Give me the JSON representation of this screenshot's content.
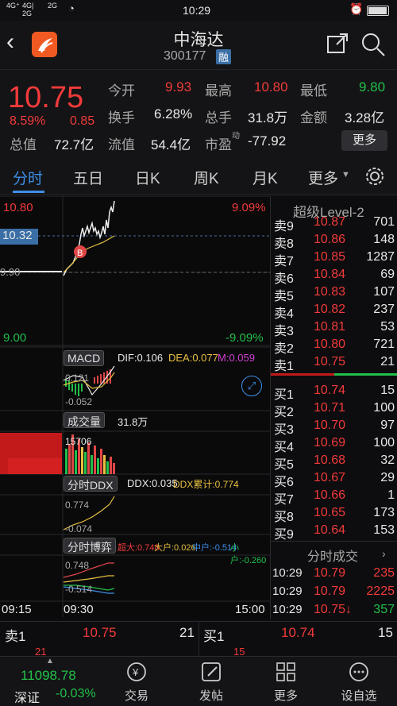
{
  "status": {
    "network_1": "4G⁺",
    "network_2": "4G|",
    "network_2b": "2G",
    "network_3": "2G",
    "time": "10:29",
    "battery": "98"
  },
  "header": {
    "title": "中海达",
    "code": "300177",
    "badge": "融"
  },
  "quote": {
    "price": "10.75",
    "change_pct": "8.59%",
    "change": "0.85",
    "rows": [
      {
        "l1": "今开",
        "v1": "9.93",
        "l2": "最高",
        "v2": "10.80",
        "l3": "最低",
        "v3": "9.80"
      },
      {
        "l1": "换手",
        "v1": "6.28%",
        "l2": "总手",
        "v2": "31.8万",
        "l3": "金额",
        "v3": "3.28亿"
      }
    ],
    "row3": {
      "l0": "总值",
      "v0": "72.7亿",
      "l1": "流值",
      "v1": "54.4亿",
      "l2": "市盈",
      "l2sup": "动",
      "v2": "-77.92"
    },
    "more_button": "更多"
  },
  "tabs": [
    "分时",
    "五日",
    "日K",
    "周K",
    "月K",
    "更多"
  ],
  "chart": {
    "top_left": "10.80",
    "top_right": "9.09%",
    "current": "10.32",
    "mid": "9.90",
    "bottom_left": "9.00",
    "bottom_right": "-9.09%",
    "marker": "B",
    "macd_label": "MACD",
    "dif": "DIF:0.106",
    "dea": "DEA:0.077",
    "m": "M:0.059",
    "macd_top": "0.121",
    "macd_bottom": "-0.052",
    "vol_label": "成交量",
    "vol_value": "31.8万",
    "vol_max": "15706",
    "ddx_label": "分时DDX",
    "ddx_value": "DDX:0.035",
    "ddx_cum": "DDX累计:0.774",
    "ddx_top": "0.774",
    "ddx_bottom": "-0.074",
    "game_label": "分时博弈",
    "game_super": "超大:0.748",
    "game_big": "大户:0.026",
    "game_mid": "中户:-0.514",
    "game_small": "小户:-0.260",
    "game_top": "0.748",
    "game_bottom": "-0.514",
    "time_start": "09:15",
    "time_mid": "09:30",
    "time_end": "15:00"
  },
  "book": {
    "title": "超级Level-2",
    "asks": [
      {
        "label": "卖9",
        "price": "10.87",
        "vol": "701"
      },
      {
        "label": "卖8",
        "price": "10.86",
        "vol": "148"
      },
      {
        "label": "卖7",
        "price": "10.85",
        "vol": "1287"
      },
      {
        "label": "卖6",
        "price": "10.84",
        "vol": "69"
      },
      {
        "label": "卖5",
        "price": "10.83",
        "vol": "107"
      },
      {
        "label": "卖4",
        "price": "10.82",
        "vol": "237"
      },
      {
        "label": "卖3",
        "price": "10.81",
        "vol": "53"
      },
      {
        "label": "卖2",
        "price": "10.80",
        "vol": "721"
      },
      {
        "label": "卖1",
        "price": "10.75",
        "vol": "21"
      }
    ],
    "bids": [
      {
        "label": "买1",
        "price": "10.74",
        "vol": "15"
      },
      {
        "label": "买2",
        "price": "10.71",
        "vol": "100"
      },
      {
        "label": "买3",
        "price": "10.70",
        "vol": "97"
      },
      {
        "label": "买4",
        "price": "10.69",
        "vol": "100"
      },
      {
        "label": "买5",
        "price": "10.68",
        "vol": "32"
      },
      {
        "label": "买6",
        "price": "10.67",
        "vol": "29"
      },
      {
        "label": "买7",
        "price": "10.66",
        "vol": "1"
      },
      {
        "label": "买8",
        "price": "10.65",
        "vol": "173"
      },
      {
        "label": "买9",
        "price": "10.64",
        "vol": "153"
      }
    ],
    "trades_title": "分时成交",
    "trades": [
      {
        "time": "10:29",
        "price": "10.79",
        "vol": "235",
        "color": "red"
      },
      {
        "time": "10:29",
        "price": "10.79",
        "vol": "2225",
        "color": "red"
      },
      {
        "time": "10:29",
        "price": "10.75↓",
        "vol": "357",
        "color": "green"
      }
    ]
  },
  "bottom_quote": {
    "sell_label": "卖1",
    "sell_price": "10.75",
    "sell_vol": "21",
    "sell_sub": "21",
    "buy_label": "买1",
    "buy_price": "10.74",
    "buy_vol": "15",
    "buy_sub": "15"
  },
  "nav": {
    "index_value": "11098.78",
    "index_name": "深证",
    "index_change": "-0.03%",
    "items": [
      "交易",
      "发帖",
      "更多",
      "设自选"
    ]
  }
}
